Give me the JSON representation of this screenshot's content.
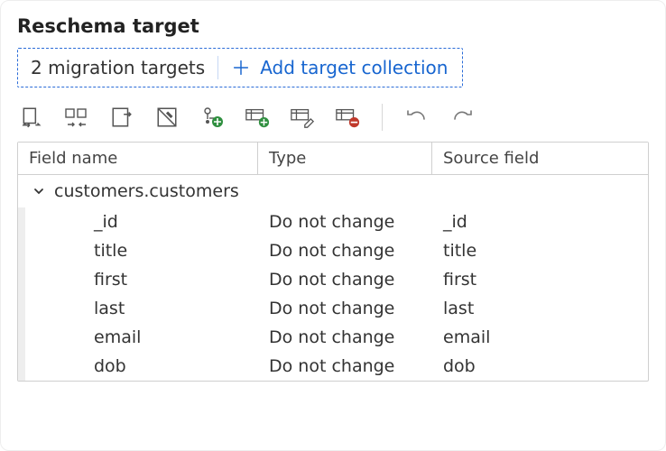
{
  "title": "Reschema target",
  "targets": {
    "count_label": "2 migration targets",
    "add_label": "Add target collection"
  },
  "toolbar": {
    "icons": [
      "move-fields-icon",
      "split-fields-icon",
      "insert-field-icon",
      "edit-field-icon",
      "field-add-icon",
      "column-add-icon",
      "column-edit-icon",
      "column-remove-icon"
    ],
    "undo": "undo-icon",
    "redo": "redo-icon"
  },
  "columns": {
    "name": "Field name",
    "type": "Type",
    "source": "Source field"
  },
  "group": {
    "label": "customers.customers",
    "expanded": true
  },
  "rows": [
    {
      "name": "_id",
      "type": "Do not change",
      "source": "_id"
    },
    {
      "name": "title",
      "type": "Do not change",
      "source": "title"
    },
    {
      "name": "first",
      "type": "Do not change",
      "source": "first"
    },
    {
      "name": "last",
      "type": "Do not change",
      "source": "last"
    },
    {
      "name": "email",
      "type": "Do not change",
      "source": "email"
    },
    {
      "name": "dob",
      "type": "Do not change",
      "source": "dob"
    }
  ]
}
